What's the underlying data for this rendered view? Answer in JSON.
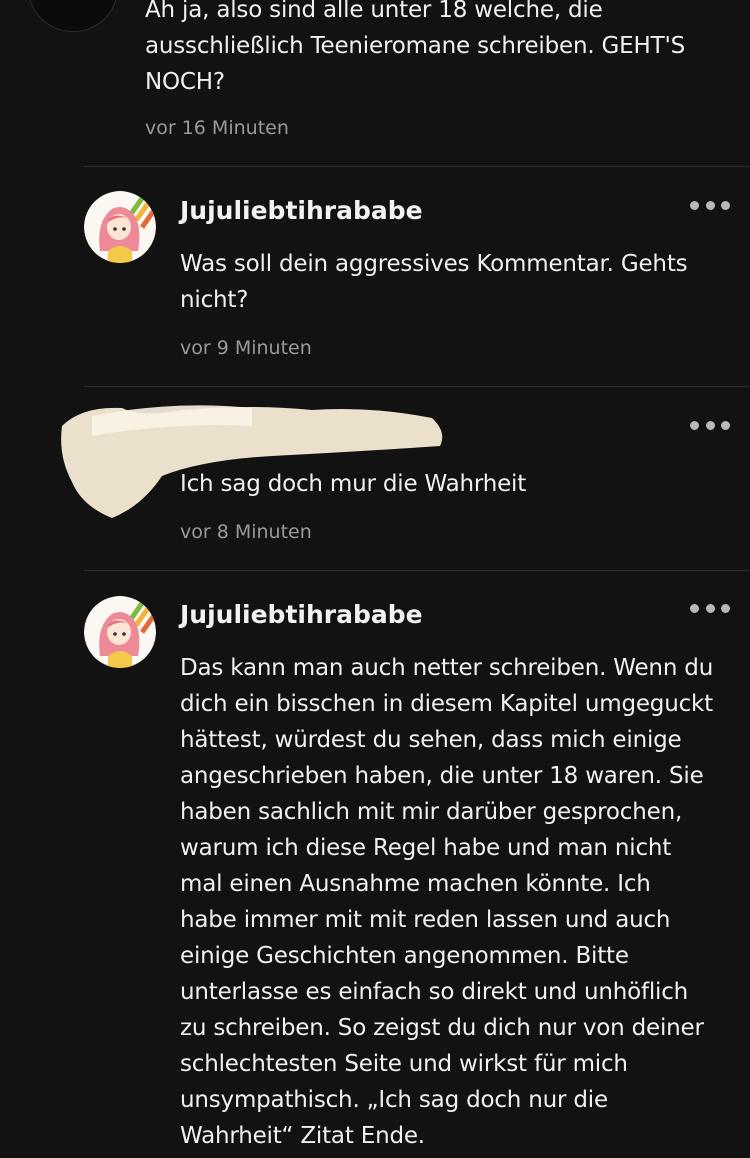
{
  "comment_top": {
    "text_lines": [
      "Ah ja, also sind alle unter 18 welche, die",
      "ausschließlich Teenieromane schreiben. GEHT'S",
      "NOCH?"
    ],
    "time": "vor 16 Minuten"
  },
  "reply_1": {
    "username": "Jujuliebtihrababe",
    "text_lines": [
      "Was soll dein aggressives Kommentar. Gehts",
      "nicht?"
    ],
    "time": "vor 9 Minuten"
  },
  "reply_2": {
    "text_lines": [
      "Ich sag doch mur die Wahrheit"
    ],
    "time": "vor 8 Minuten"
  },
  "reply_3": {
    "username": "Jujuliebtihrababe",
    "text_lines": [
      "Das kann man auch netter schreiben. Wenn du",
      "dich ein bisschen in diesem Kapitel umgeguckt",
      "hättest, würdest du sehen, dass mich einige",
      "angeschrieben haben, die unter 18 waren. Sie",
      "haben sachlich mit mir darüber gesprochen,",
      "warum ich diese Regel habe und man nicht",
      "mal einen Ausnahme machen könnte. Ich",
      "habe immer mit mit reden lassen und auch",
      "einige Geschichten angenommen. Bitte",
      "unterlasse es einfach so direkt und unhöflich",
      "zu schreiben. So zeigst du dich nur von deiner",
      "schlechtesten Seite und wirkst für mich",
      "unsympathisch. „Ich sag doch nur die",
      "Wahrheit“ Zitat Ende."
    ]
  },
  "colors": {
    "background": "#121212",
    "text": "#f0f0f0",
    "muted": "#9a9a9a",
    "divider": "#2d2d2d",
    "redaction": "#f7ecd6"
  },
  "icons": {
    "more": "more-horizontal-icon",
    "avatar": "avatar-icon"
  }
}
